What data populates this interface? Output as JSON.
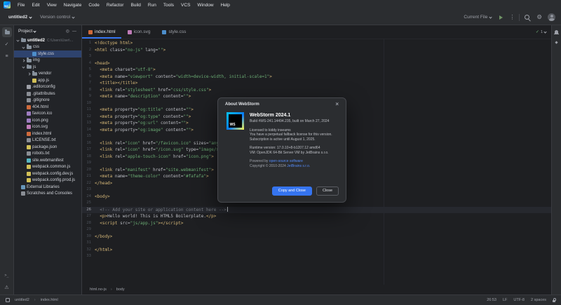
{
  "accent": "#3574f0",
  "menu": {
    "logo": "WS",
    "items": [
      "File",
      "Edit",
      "View",
      "Navigate",
      "Code",
      "Refactor",
      "Build",
      "Run",
      "Tools",
      "VCS",
      "Window",
      "Help"
    ]
  },
  "toolbar": {
    "project": "untitled2",
    "vcs": "Version control",
    "run_config": "Current File"
  },
  "project": {
    "header": "Project",
    "items": [
      {
        "label": "untitled2",
        "path": "C:\\Users\\User\\WebstormProjects\\untitled2",
        "indent": 0,
        "icon": "folder",
        "chevron": "down",
        "bold": true
      },
      {
        "label": "css",
        "indent": 1,
        "icon": "folder",
        "chevron": "down"
      },
      {
        "label": "style.css",
        "indent": 2,
        "icon": "css",
        "selected": true
      },
      {
        "label": "img",
        "indent": 1,
        "icon": "folder",
        "chevron": "right"
      },
      {
        "label": "js",
        "indent": 1,
        "icon": "folder",
        "chevron": "down"
      },
      {
        "label": "vendor",
        "indent": 2,
        "icon": "folder",
        "chevron": "right"
      },
      {
        "label": "app.js",
        "indent": 2,
        "icon": "js"
      },
      {
        "label": ".editorconfig",
        "indent": 1,
        "icon": "config"
      },
      {
        "label": ".gitattributes",
        "indent": 1,
        "icon": "git"
      },
      {
        "label": ".gitignore",
        "indent": 1,
        "icon": "git"
      },
      {
        "label": "404.html",
        "indent": 1,
        "icon": "html"
      },
      {
        "label": "favicon.ico",
        "indent": 1,
        "icon": "image"
      },
      {
        "label": "icon.png",
        "indent": 1,
        "icon": "image"
      },
      {
        "label": "icon.svg",
        "indent": 1,
        "icon": "svg"
      },
      {
        "label": "index.html",
        "indent": 1,
        "icon": "html"
      },
      {
        "label": "LICENSE.txt",
        "indent": 1,
        "icon": "text"
      },
      {
        "label": "package.json",
        "indent": 1,
        "icon": "json"
      },
      {
        "label": "robots.txt",
        "indent": 1,
        "icon": "text"
      },
      {
        "label": "site.webmanifest",
        "indent": 1,
        "icon": "manifest"
      },
      {
        "label": "webpack.common.js",
        "indent": 1,
        "icon": "js"
      },
      {
        "label": "webpack.config.dev.js",
        "indent": 1,
        "icon": "js"
      },
      {
        "label": "webpack.config.prod.js",
        "indent": 1,
        "icon": "js"
      },
      {
        "label": "External Libraries",
        "indent": 0,
        "icon": "lib"
      },
      {
        "label": "Scratches and Consoles",
        "indent": 0,
        "icon": "scratch"
      }
    ]
  },
  "tabs": [
    {
      "label": "index.html",
      "icon": "html",
      "active": true
    },
    {
      "label": "icon.svg",
      "icon": "svg",
      "active": false
    },
    {
      "label": "style.css",
      "icon": "css",
      "active": false
    }
  ],
  "editor": {
    "inspections": "1",
    "active_line": 26,
    "lines": [
      {
        "n": 1,
        "seg": [
          [
            "t",
            "<!doctype html>"
          ]
        ]
      },
      {
        "n": 2,
        "seg": [
          [
            "t",
            "<html "
          ],
          [
            "a",
            "class="
          ],
          [
            "s",
            "\"no-js\""
          ],
          [
            "a",
            " lang="
          ],
          [
            "s",
            "\"\""
          ],
          [
            "t",
            ">"
          ]
        ]
      },
      {
        "n": 3,
        "seg": []
      },
      {
        "n": 4,
        "seg": [
          [
            "t",
            "<head>"
          ]
        ]
      },
      {
        "n": 5,
        "seg": [
          [
            "t",
            "  <meta "
          ],
          [
            "a",
            "charset="
          ],
          [
            "s",
            "\"utf-8\""
          ],
          [
            "t",
            ">"
          ]
        ]
      },
      {
        "n": 6,
        "seg": [
          [
            "t",
            "  <meta "
          ],
          [
            "a",
            "name="
          ],
          [
            "s",
            "\"viewport\""
          ],
          [
            "a",
            " content="
          ],
          [
            "s",
            "\"width=device-width, initial-scale=1\""
          ],
          [
            "t",
            ">"
          ]
        ]
      },
      {
        "n": 7,
        "seg": [
          [
            "t",
            "  <title></title>"
          ]
        ]
      },
      {
        "n": 8,
        "seg": [
          [
            "t",
            "  <link "
          ],
          [
            "a",
            "rel="
          ],
          [
            "s",
            "\"stylesheet\""
          ],
          [
            "a",
            " href="
          ],
          [
            "s",
            "\"css/style.css\""
          ],
          [
            "t",
            ">"
          ]
        ]
      },
      {
        "n": 9,
        "seg": [
          [
            "t",
            "  <meta "
          ],
          [
            "a",
            "name="
          ],
          [
            "s",
            "\"description\""
          ],
          [
            "a",
            " content="
          ],
          [
            "s",
            "\"\""
          ],
          [
            "t",
            ">"
          ]
        ]
      },
      {
        "n": 10,
        "seg": []
      },
      {
        "n": 11,
        "seg": [
          [
            "t",
            "  <meta "
          ],
          [
            "a",
            "property="
          ],
          [
            "s",
            "\"og:title\""
          ],
          [
            "a",
            " content="
          ],
          [
            "s",
            "\"\""
          ],
          [
            "t",
            ">"
          ]
        ]
      },
      {
        "n": 12,
        "seg": [
          [
            "t",
            "  <meta "
          ],
          [
            "a",
            "property="
          ],
          [
            "s",
            "\"og:type\""
          ],
          [
            "a",
            " content="
          ],
          [
            "s",
            "\"\""
          ],
          [
            "t",
            ">"
          ]
        ]
      },
      {
        "n": 13,
        "seg": [
          [
            "t",
            "  <meta "
          ],
          [
            "a",
            "property="
          ],
          [
            "s",
            "\"og:url\""
          ],
          [
            "a",
            " content="
          ],
          [
            "s",
            "\"\""
          ],
          [
            "t",
            ">"
          ]
        ]
      },
      {
        "n": 14,
        "seg": [
          [
            "t",
            "  <meta "
          ],
          [
            "a",
            "property="
          ],
          [
            "s",
            "\"og:image\""
          ],
          [
            "a",
            " content="
          ],
          [
            "s",
            "\"\""
          ],
          [
            "t",
            ">"
          ]
        ]
      },
      {
        "n": 15,
        "seg": []
      },
      {
        "n": 16,
        "seg": [
          [
            "t",
            "  <link "
          ],
          [
            "a",
            "rel="
          ],
          [
            "s",
            "\"icon\""
          ],
          [
            "a",
            " href="
          ],
          [
            "s",
            "\"/favicon.ico\""
          ],
          [
            "a",
            " sizes="
          ],
          [
            "s",
            "\"any\""
          ],
          [
            "t",
            ">"
          ]
        ]
      },
      {
        "n": 17,
        "seg": [
          [
            "t",
            "  <link "
          ],
          [
            "a",
            "rel="
          ],
          [
            "s",
            "\"icon\""
          ],
          [
            "a",
            " href="
          ],
          [
            "s",
            "\"/icon.svg\""
          ],
          [
            "a",
            " type="
          ],
          [
            "s",
            "\"image/svg+xml\""
          ],
          [
            "t",
            ">"
          ]
        ]
      },
      {
        "n": 18,
        "seg": [
          [
            "t",
            "  <link "
          ],
          [
            "a",
            "rel="
          ],
          [
            "s",
            "\"apple-touch-icon\""
          ],
          [
            "a",
            " href="
          ],
          [
            "s",
            "\"icon.png\""
          ],
          [
            "t",
            ">"
          ]
        ]
      },
      {
        "n": 19,
        "seg": []
      },
      {
        "n": 20,
        "seg": [
          [
            "t",
            "  <link "
          ],
          [
            "a",
            "rel="
          ],
          [
            "s",
            "\"manifest\""
          ],
          [
            "a",
            " href="
          ],
          [
            "s",
            "\"site.webmanifest\""
          ],
          [
            "t",
            ">"
          ]
        ]
      },
      {
        "n": 21,
        "seg": [
          [
            "t",
            "  <meta "
          ],
          [
            "a",
            "name="
          ],
          [
            "s",
            "\"theme-color\""
          ],
          [
            "a",
            " content="
          ],
          [
            "s",
            "\"#fafafa\""
          ],
          [
            "t",
            ">"
          ]
        ]
      },
      {
        "n": 22,
        "seg": [
          [
            "t",
            "</head>"
          ]
        ]
      },
      {
        "n": 23,
        "seg": []
      },
      {
        "n": 24,
        "seg": [
          [
            "t",
            "<body>"
          ]
        ]
      },
      {
        "n": 25,
        "seg": []
      },
      {
        "n": 26,
        "seg": [
          [
            "c",
            "  <!-- Add your site or application content here -->"
          ]
        ]
      },
      {
        "n": 27,
        "seg": [
          [
            "t",
            "  <p>"
          ],
          [
            "p",
            "Hello world! This is HTML5 Boilerplate."
          ],
          [
            "t",
            "</p>"
          ]
        ]
      },
      {
        "n": 28,
        "seg": [
          [
            "t",
            "  <script "
          ],
          [
            "a",
            "src="
          ],
          [
            "s",
            "\"js/app.js\""
          ],
          [
            "t",
            "></script>"
          ]
        ]
      },
      {
        "n": 29,
        "seg": []
      },
      {
        "n": 30,
        "seg": [
          [
            "t",
            "</body>"
          ]
        ]
      },
      {
        "n": 31,
        "seg": []
      },
      {
        "n": 32,
        "seg": [
          [
            "t",
            "</html>"
          ]
        ]
      },
      {
        "n": 33,
        "seg": []
      }
    ]
  },
  "breadcrumbs": [
    "html.no-js",
    "body"
  ],
  "status": {
    "left": [
      "untitled2",
      "index.html"
    ],
    "position": "26:53",
    "line_sep": "LF",
    "encoding": "UTF-8",
    "indent": "2 spaces"
  },
  "dialog": {
    "title": "About WebStorm",
    "close": "×",
    "logo_text": "WS",
    "product": "WebStorm 2024.1",
    "build": "Build #WS-241.14494.235, built on March 27, 2024",
    "licensed_to": "Licensed to kiddy inseams",
    "license_line1": "You have a perpetual fallback license for this version.",
    "license_line2": "Subscription is active until August 1, 2025.",
    "runtime": "Runtime version: 17.0.10+8-b1207.12 amd64",
    "vm": "VM: OpenJDK 64-Bit Server VM by JetBrains s.r.o.",
    "powered_prefix": "Powered by ",
    "powered_link": "open-source software",
    "copyright_prefix": "Copyright © 2010-2024 ",
    "copyright_link": "JetBrains s.r.o.",
    "buttons": {
      "primary": "Copy and Close",
      "secondary": "Close"
    }
  }
}
